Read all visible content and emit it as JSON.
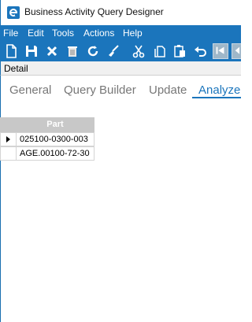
{
  "window": {
    "title": "Business Activity Query Designer"
  },
  "menu": {
    "file": "File",
    "edit": "Edit",
    "tools": "Tools",
    "actions": "Actions",
    "help": "Help"
  },
  "section": {
    "label": "Detail"
  },
  "tabs": [
    {
      "label": "General"
    },
    {
      "label": "Query Builder"
    },
    {
      "label": "Update"
    },
    {
      "label": "Analyze"
    }
  ],
  "grid": {
    "header": "Part",
    "rows": [
      {
        "part": "025100-0300-003"
      },
      {
        "part": "AGE.00100-72-30"
      }
    ]
  },
  "colors": {
    "accent": "#1b75bc"
  }
}
